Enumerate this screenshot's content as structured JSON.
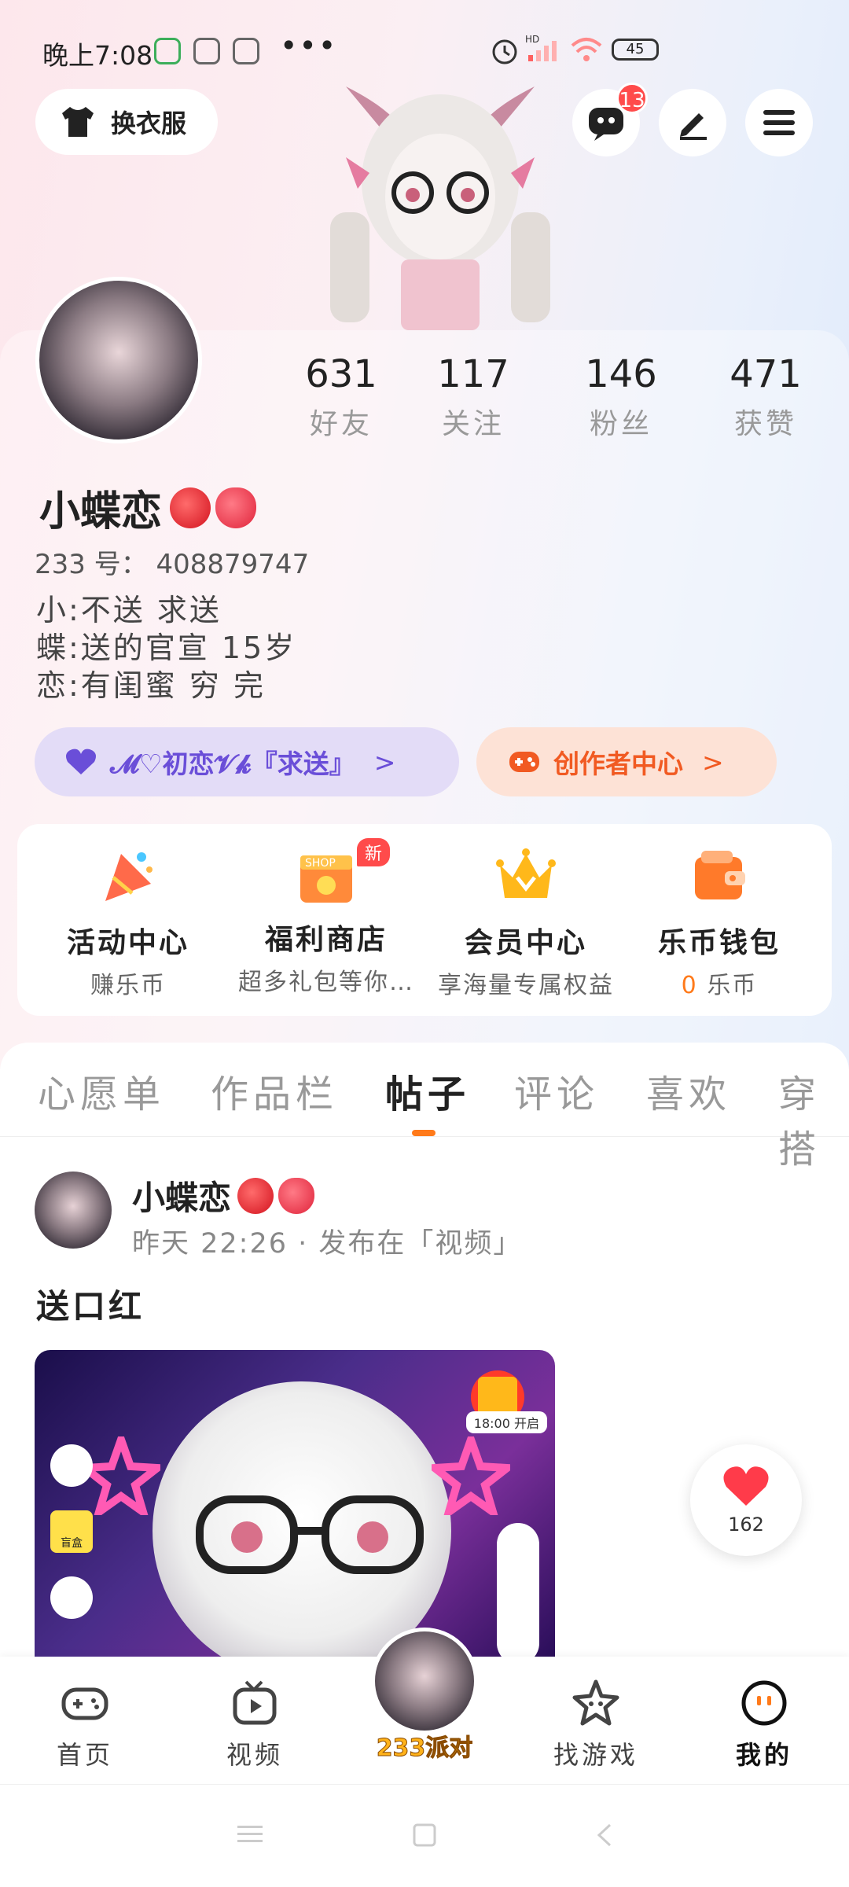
{
  "status_bar": {
    "time": "晚上7:08",
    "more": "•••",
    "battery": "45"
  },
  "header": {
    "outfit_label": "换衣服",
    "message_badge": "13"
  },
  "profile": {
    "stats": [
      {
        "value": "631",
        "label": "好友"
      },
      {
        "value": "117",
        "label": "关注"
      },
      {
        "value": "146",
        "label": "粉丝"
      },
      {
        "value": "471",
        "label": "获赞"
      }
    ],
    "name": "小蝶恋",
    "uid": "233 号：  408879747",
    "bio": "小:不送 求送\n蝶:送的官宣 15岁\n恋:有闺蜜 穷 完",
    "pill_left": "𝓜♡初恋𝓥𝓴『求送』",
    "pill_right": "创作者中心",
    "chevron": ">"
  },
  "quick_menu": [
    {
      "title": "活动中心",
      "sub": "赚乐币"
    },
    {
      "title": "福利商店",
      "sub": "超多礼包等你…",
      "badge": "新",
      "badge_text": "SHOP"
    },
    {
      "title": "会员中心",
      "sub": "享海量专属权益"
    },
    {
      "title": "乐币钱包",
      "sub_num": "0",
      "sub": "乐币"
    }
  ],
  "tabs": [
    "心愿单",
    "作品栏",
    "帖子",
    "评论",
    "喜欢",
    "穿搭"
  ],
  "active_tab": "帖子",
  "post": {
    "author": "小蝶恋",
    "meta": "昨天 22:26 · 发布在「视频」",
    "text": "送口红",
    "image_event_time": "18:00 开启",
    "image_badge": "盲盒"
  },
  "like": {
    "count": "162"
  },
  "bottom_nav": {
    "items": [
      {
        "label": "首页",
        "icon": "gamepad-icon"
      },
      {
        "label": "视频",
        "icon": "tv-icon"
      },
      {
        "label": "找游戏",
        "icon": "star-face-icon"
      },
      {
        "label": "我的",
        "icon": "smile-icon"
      }
    ],
    "center_label": "233派对"
  },
  "colors": {
    "accent": "#ff7a1a",
    "purple": "#6a4ed8",
    "badge": "#ff4b4b"
  }
}
